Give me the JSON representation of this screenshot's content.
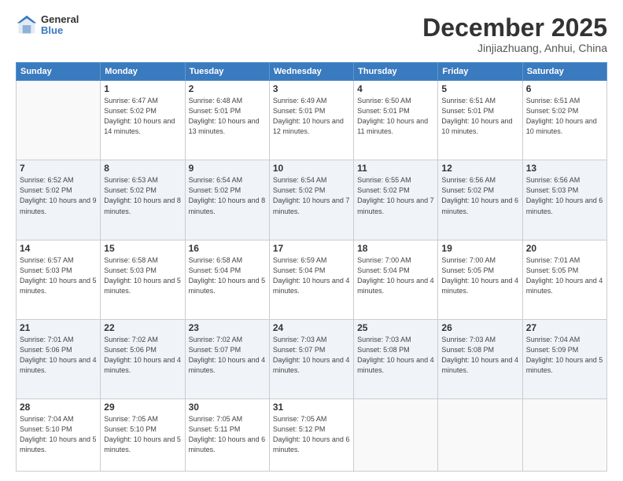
{
  "header": {
    "logo_general": "General",
    "logo_blue": "Blue",
    "month": "December 2025",
    "location": "Jinjiazhuang, Anhui, China"
  },
  "weekdays": [
    "Sunday",
    "Monday",
    "Tuesday",
    "Wednesday",
    "Thursday",
    "Friday",
    "Saturday"
  ],
  "weeks": [
    [
      {
        "day": "",
        "sunrise": "",
        "sunset": "",
        "daylight": ""
      },
      {
        "day": "1",
        "sunrise": "Sunrise: 6:47 AM",
        "sunset": "Sunset: 5:02 PM",
        "daylight": "Daylight: 10 hours and 14 minutes."
      },
      {
        "day": "2",
        "sunrise": "Sunrise: 6:48 AM",
        "sunset": "Sunset: 5:01 PM",
        "daylight": "Daylight: 10 hours and 13 minutes."
      },
      {
        "day": "3",
        "sunrise": "Sunrise: 6:49 AM",
        "sunset": "Sunset: 5:01 PM",
        "daylight": "Daylight: 10 hours and 12 minutes."
      },
      {
        "day": "4",
        "sunrise": "Sunrise: 6:50 AM",
        "sunset": "Sunset: 5:01 PM",
        "daylight": "Daylight: 10 hours and 11 minutes."
      },
      {
        "day": "5",
        "sunrise": "Sunrise: 6:51 AM",
        "sunset": "Sunset: 5:01 PM",
        "daylight": "Daylight: 10 hours and 10 minutes."
      },
      {
        "day": "6",
        "sunrise": "Sunrise: 6:51 AM",
        "sunset": "Sunset: 5:02 PM",
        "daylight": "Daylight: 10 hours and 10 minutes."
      }
    ],
    [
      {
        "day": "7",
        "sunrise": "Sunrise: 6:52 AM",
        "sunset": "Sunset: 5:02 PM",
        "daylight": "Daylight: 10 hours and 9 minutes."
      },
      {
        "day": "8",
        "sunrise": "Sunrise: 6:53 AM",
        "sunset": "Sunset: 5:02 PM",
        "daylight": "Daylight: 10 hours and 8 minutes."
      },
      {
        "day": "9",
        "sunrise": "Sunrise: 6:54 AM",
        "sunset": "Sunset: 5:02 PM",
        "daylight": "Daylight: 10 hours and 8 minutes."
      },
      {
        "day": "10",
        "sunrise": "Sunrise: 6:54 AM",
        "sunset": "Sunset: 5:02 PM",
        "daylight": "Daylight: 10 hours and 7 minutes."
      },
      {
        "day": "11",
        "sunrise": "Sunrise: 6:55 AM",
        "sunset": "Sunset: 5:02 PM",
        "daylight": "Daylight: 10 hours and 7 minutes."
      },
      {
        "day": "12",
        "sunrise": "Sunrise: 6:56 AM",
        "sunset": "Sunset: 5:02 PM",
        "daylight": "Daylight: 10 hours and 6 minutes."
      },
      {
        "day": "13",
        "sunrise": "Sunrise: 6:56 AM",
        "sunset": "Sunset: 5:03 PM",
        "daylight": "Daylight: 10 hours and 6 minutes."
      }
    ],
    [
      {
        "day": "14",
        "sunrise": "Sunrise: 6:57 AM",
        "sunset": "Sunset: 5:03 PM",
        "daylight": "Daylight: 10 hours and 5 minutes."
      },
      {
        "day": "15",
        "sunrise": "Sunrise: 6:58 AM",
        "sunset": "Sunset: 5:03 PM",
        "daylight": "Daylight: 10 hours and 5 minutes."
      },
      {
        "day": "16",
        "sunrise": "Sunrise: 6:58 AM",
        "sunset": "Sunset: 5:04 PM",
        "daylight": "Daylight: 10 hours and 5 minutes."
      },
      {
        "day": "17",
        "sunrise": "Sunrise: 6:59 AM",
        "sunset": "Sunset: 5:04 PM",
        "daylight": "Daylight: 10 hours and 4 minutes."
      },
      {
        "day": "18",
        "sunrise": "Sunrise: 7:00 AM",
        "sunset": "Sunset: 5:04 PM",
        "daylight": "Daylight: 10 hours and 4 minutes."
      },
      {
        "day": "19",
        "sunrise": "Sunrise: 7:00 AM",
        "sunset": "Sunset: 5:05 PM",
        "daylight": "Daylight: 10 hours and 4 minutes."
      },
      {
        "day": "20",
        "sunrise": "Sunrise: 7:01 AM",
        "sunset": "Sunset: 5:05 PM",
        "daylight": "Daylight: 10 hours and 4 minutes."
      }
    ],
    [
      {
        "day": "21",
        "sunrise": "Sunrise: 7:01 AM",
        "sunset": "Sunset: 5:06 PM",
        "daylight": "Daylight: 10 hours and 4 minutes."
      },
      {
        "day": "22",
        "sunrise": "Sunrise: 7:02 AM",
        "sunset": "Sunset: 5:06 PM",
        "daylight": "Daylight: 10 hours and 4 minutes."
      },
      {
        "day": "23",
        "sunrise": "Sunrise: 7:02 AM",
        "sunset": "Sunset: 5:07 PM",
        "daylight": "Daylight: 10 hours and 4 minutes."
      },
      {
        "day": "24",
        "sunrise": "Sunrise: 7:03 AM",
        "sunset": "Sunset: 5:07 PM",
        "daylight": "Daylight: 10 hours and 4 minutes."
      },
      {
        "day": "25",
        "sunrise": "Sunrise: 7:03 AM",
        "sunset": "Sunset: 5:08 PM",
        "daylight": "Daylight: 10 hours and 4 minutes."
      },
      {
        "day": "26",
        "sunrise": "Sunrise: 7:03 AM",
        "sunset": "Sunset: 5:08 PM",
        "daylight": "Daylight: 10 hours and 4 minutes."
      },
      {
        "day": "27",
        "sunrise": "Sunrise: 7:04 AM",
        "sunset": "Sunset: 5:09 PM",
        "daylight": "Daylight: 10 hours and 5 minutes."
      }
    ],
    [
      {
        "day": "28",
        "sunrise": "Sunrise: 7:04 AM",
        "sunset": "Sunset: 5:10 PM",
        "daylight": "Daylight: 10 hours and 5 minutes."
      },
      {
        "day": "29",
        "sunrise": "Sunrise: 7:05 AM",
        "sunset": "Sunset: 5:10 PM",
        "daylight": "Daylight: 10 hours and 5 minutes."
      },
      {
        "day": "30",
        "sunrise": "Sunrise: 7:05 AM",
        "sunset": "Sunset: 5:11 PM",
        "daylight": "Daylight: 10 hours and 6 minutes."
      },
      {
        "day": "31",
        "sunrise": "Sunrise: 7:05 AM",
        "sunset": "Sunset: 5:12 PM",
        "daylight": "Daylight: 10 hours and 6 minutes."
      },
      {
        "day": "",
        "sunrise": "",
        "sunset": "",
        "daylight": ""
      },
      {
        "day": "",
        "sunrise": "",
        "sunset": "",
        "daylight": ""
      },
      {
        "day": "",
        "sunrise": "",
        "sunset": "",
        "daylight": ""
      }
    ]
  ]
}
